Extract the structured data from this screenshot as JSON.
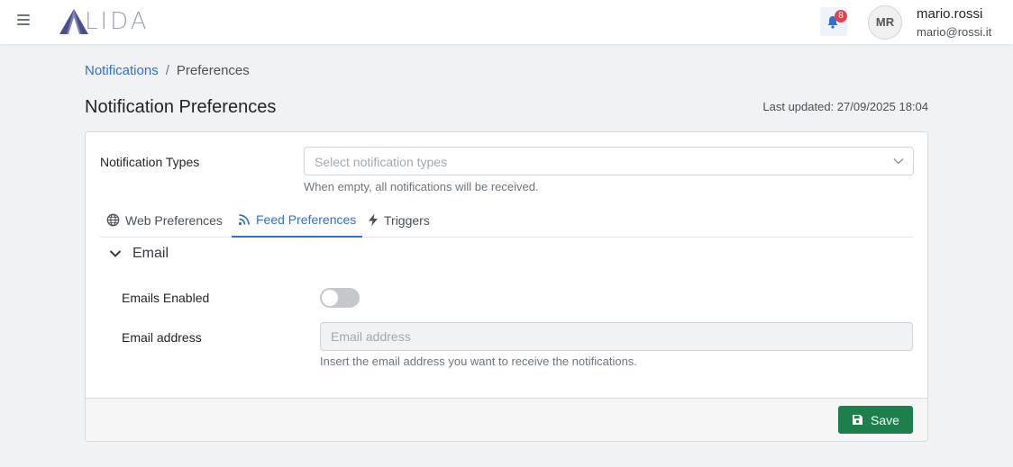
{
  "header": {
    "logo_text": "LIDA",
    "notification_count": "8",
    "user": {
      "initials": "MR",
      "name": "mario.rossi",
      "email": "mario@rossi.it"
    }
  },
  "breadcrumb": {
    "parent": "Notifications",
    "separator": "/",
    "current": "Preferences"
  },
  "page": {
    "title": "Notification Preferences",
    "last_updated": "Last updated: 27/09/2025 18:04"
  },
  "form": {
    "notification_types": {
      "label": "Notification Types",
      "placeholder": "Select notification types",
      "hint": "When empty, all notifications will be received."
    },
    "tabs": [
      {
        "label": "Web Preferences",
        "icon": "globe-icon",
        "active": false
      },
      {
        "label": "Feed Preferences",
        "icon": "rss-icon",
        "active": true
      },
      {
        "label": "Triggers",
        "icon": "bolt-icon",
        "active": false
      }
    ],
    "email_section": {
      "title": "Email",
      "emails_enabled_label": "Emails Enabled",
      "emails_enabled": false,
      "email_address_label": "Email address",
      "email_address_value": "",
      "email_address_placeholder": "Email address",
      "email_address_hint": "Insert the email address you want to receive the notifications."
    }
  },
  "footer": {
    "save_label": "Save"
  },
  "colors": {
    "primary": "#2f6fd6",
    "save": "#1d7f4b",
    "badge": "#e2434f"
  }
}
